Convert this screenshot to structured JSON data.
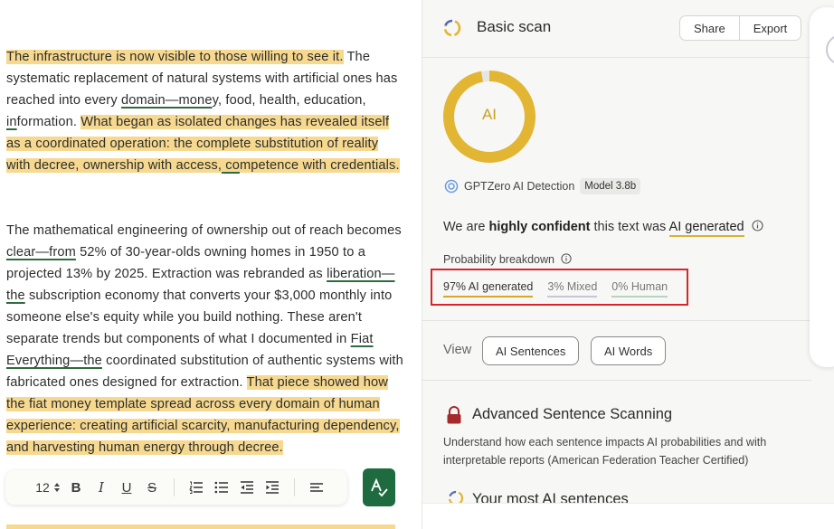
{
  "editor": {
    "p1": [
      {
        "t": "The infrastructure is now visible to those willing to see it.",
        "hl": true
      },
      {
        "t": " The systematic replacement of natural systems with artificial ones has reached into every "
      },
      {
        "t": "domain—mone",
        "ul": true
      },
      {
        "t": "y, food, health, education,"
      },
      {
        "t": " in",
        "ul": true
      },
      {
        "t": "formation. "
      },
      {
        "t": "What began as isolated changes has revealed itself as a coordinated operation: the complete substitution of reality with decree, ownership with access,",
        "hl": true
      },
      {
        "t": " co",
        "hl": true,
        "ul": true
      },
      {
        "t": "mpetence with credentials.",
        "hl": true
      }
    ],
    "p2": [
      {
        "t": "The mathematical engineering of ownership out of reach becomes "
      },
      {
        "t": "clear—from",
        "ul": true
      },
      {
        "t": " 52% of 30-year-olds owning homes in 1950 to a projected 13% by 2025. Extraction was rebranded as "
      },
      {
        "t": "liberation—the",
        "ul": true
      },
      {
        "t": " subscription economy that converts your $3,000 monthly into someone else's equity while you build nothing. These aren't separate trends but components of what I documented in "
      },
      {
        "t": "Fiat Everything—the",
        "ul": true
      },
      {
        "t": " coordinated substitution of authentic systems with fabricated ones designed for extraction. "
      },
      {
        "t": "That piece showed how the fiat money template spread across every domain of human experience: creating artificial scarcity, manufacturing dependency, and harvesting human energy through decree.",
        "hl": true
      }
    ]
  },
  "toolbar": {
    "font_size": "12",
    "bold": "B",
    "italic": "I",
    "underline": "U",
    "strike": "S",
    "icons": [
      "numbered-list-icon",
      "bulleted-list-icon",
      "outdent-icon",
      "indent-icon",
      "align-left-icon"
    ]
  },
  "panel": {
    "title": "Basic scan",
    "share": "Share",
    "export": "Export",
    "donut_label": "AI",
    "ai_fraction": 0.97,
    "detector_name": "GPTZero AI Detection",
    "model": "Model 3.8b",
    "verdict_prefix": "We are ",
    "verdict_bold": "highly confident",
    "verdict_mid": " this text was ",
    "verdict_result": "AI generated",
    "breakdown_label": "Probability breakdown",
    "probs": {
      "ai": "97% AI generated",
      "mixed": "3% Mixed",
      "human": "0% Human"
    },
    "view_label": "View",
    "ai_sentences": "AI Sentences",
    "ai_words": "AI Words",
    "advanced_title": "Advanced Sentence Scanning",
    "advanced_desc": "Understand how each sentence impacts AI probabilities and with interpretable reports (American Federation Teacher Certified)",
    "most_title": "Your most AI sentences"
  },
  "colors": {
    "highlight": "#f6d98f",
    "ai_gold": "#e2b633",
    "brand_green": "#1d6b3e",
    "alert_red": "#d9242a"
  }
}
